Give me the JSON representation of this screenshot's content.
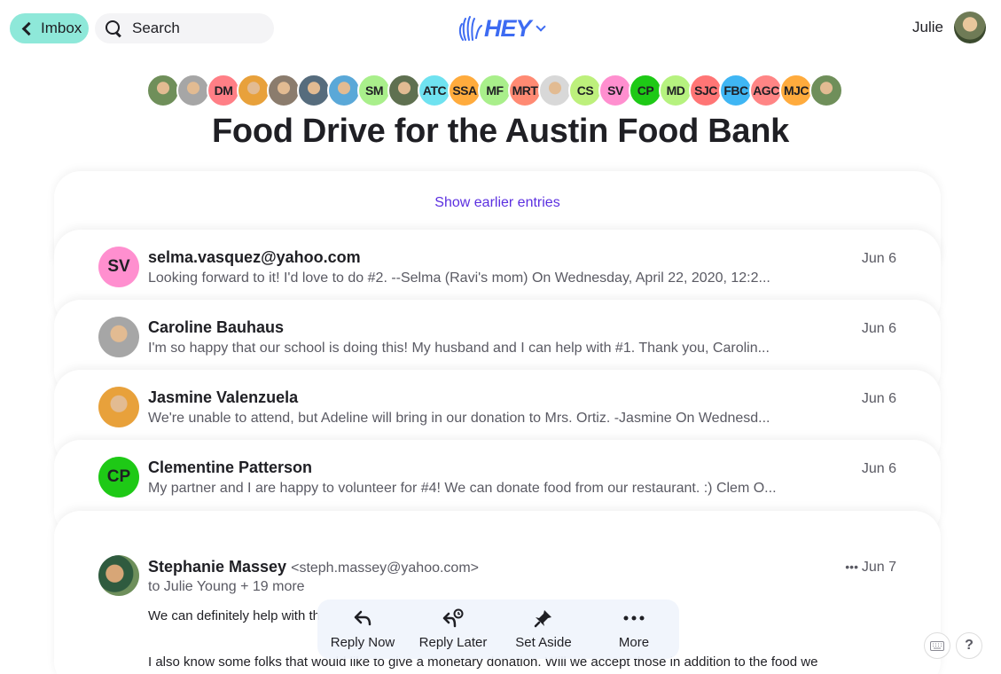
{
  "topbar": {
    "back_label": "Imbox",
    "search_label": "Search",
    "logo_text": "HEY",
    "user_name": "Julie"
  },
  "participants": [
    {
      "initials": "",
      "color": "#6f8f5a",
      "kind": "photo"
    },
    {
      "initials": "",
      "color": "#a6a6a6",
      "kind": "photo"
    },
    {
      "initials": "DM",
      "color": "#ff7f86"
    },
    {
      "initials": "",
      "color": "#e8a13b",
      "kind": "photo"
    },
    {
      "initials": "",
      "color": "#8b7c6d",
      "kind": "photo"
    },
    {
      "initials": "",
      "color": "#566c7d",
      "kind": "photo"
    },
    {
      "initials": "",
      "color": "#5aa8d8",
      "kind": "photo"
    },
    {
      "initials": "SM",
      "color": "#a9ef8b"
    },
    {
      "initials": "",
      "color": "#5f7050",
      "kind": "photo"
    },
    {
      "initials": "ATC",
      "color": "#6fe2f0"
    },
    {
      "initials": "SSA",
      "color": "#ffab3d"
    },
    {
      "initials": "MF",
      "color": "#a9ef8b"
    },
    {
      "initials": "MRT",
      "color": "#ff8a73"
    },
    {
      "initials": "",
      "color": "#d8d8d8",
      "kind": "photo"
    },
    {
      "initials": "CS",
      "color": "#bdf07c"
    },
    {
      "initials": "SV",
      "color": "#ff8fcf"
    },
    {
      "initials": "CP",
      "color": "#1ec916"
    },
    {
      "initials": "MD",
      "color": "#b6f27f"
    },
    {
      "initials": "SJC",
      "color": "#ff7575"
    },
    {
      "initials": "FBC",
      "color": "#3fb6f4"
    },
    {
      "initials": "AGC",
      "color": "#ff8585"
    },
    {
      "initials": "MJC",
      "color": "#ffab3d"
    },
    {
      "initials": "",
      "color": "#6f8f5a",
      "kind": "photo"
    }
  ],
  "thread": {
    "title": "Food Drive for the Austin Food Bank",
    "show_earlier": "Show earlier entries"
  },
  "entries": [
    {
      "initials": "SV",
      "color": "#ff8fcf",
      "name": "selma.vasquez@yahoo.com",
      "snippet": "Looking forward to it! I'd love to do #2. --Selma (Ravi's mom) On Wednesday, April 22, 2020, 12:2...",
      "date": "Jun 6"
    },
    {
      "initials": "",
      "color": "#a6a6a6",
      "name": "Caroline Bauhaus",
      "snippet": "I'm so happy that our school is doing this! My husband and I can help with #1. Thank you, Carolin...",
      "date": "Jun 6"
    },
    {
      "initials": "",
      "color": "#e8a13b",
      "name": "Jasmine Valenzuela",
      "snippet": "We're unable to attend, but Adeline will bring in our donation to Mrs. Ortiz. -Jasmine On Wednesd...",
      "date": "Jun 6"
    },
    {
      "initials": "CP",
      "color": "#1ec916",
      "name": "Clementine Patterson",
      "snippet": "My partner and I are happy to volunteer for #4! We can donate food from our restaurant. :) Clem O...",
      "date": "Jun 6"
    }
  ],
  "open_message": {
    "name": "Stephanie Massey",
    "address": "<steph.massey@yahoo.com>",
    "to": "to Julie Young + 19 more",
    "date": "Jun 7",
    "body_line1": "We can definitely help with th",
    "body_line2": "I also know some folks that would like to give a monetary donation. Will we accept those in addition to the food we"
  },
  "actions": [
    {
      "label": "Reply Now",
      "icon": "reply-icon"
    },
    {
      "label": "Reply Later",
      "icon": "reply-later-icon"
    },
    {
      "label": "Set Aside",
      "icon": "pin-icon"
    },
    {
      "label": "More",
      "icon": "more-icon"
    }
  ],
  "help_label": "?"
}
